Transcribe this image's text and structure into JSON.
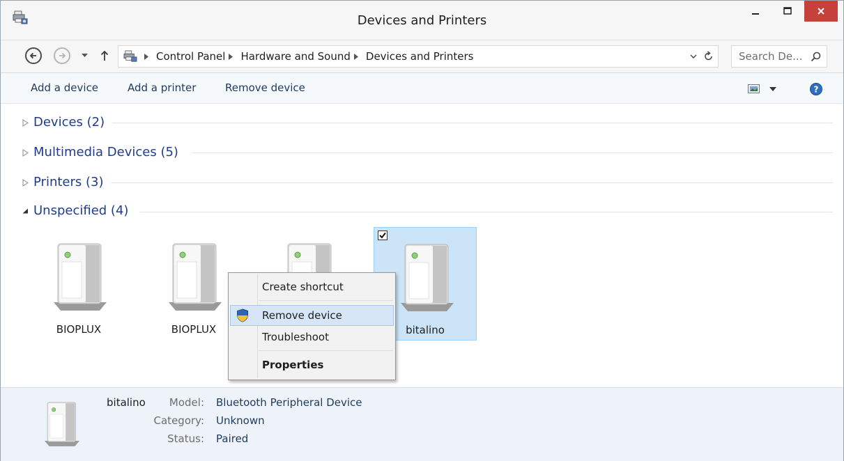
{
  "window": {
    "title": "Devices and Printers"
  },
  "address": {
    "crumbs": [
      "Control Panel",
      "Hardware and Sound",
      "Devices and Printers"
    ],
    "search_placeholder": "Search De..."
  },
  "toolbar": {
    "add_device": "Add a device",
    "add_printer": "Add a printer",
    "remove_device": "Remove device"
  },
  "groups": [
    {
      "label": "Devices (2)",
      "expanded": false
    },
    {
      "label": "Multimedia Devices (5)",
      "expanded": false
    },
    {
      "label": "Printers (3)",
      "expanded": false
    },
    {
      "label": "Unspecified (4)",
      "expanded": true
    }
  ],
  "devices": [
    {
      "label": "BIOPLUX",
      "selected": false
    },
    {
      "label": "BIOPLUX",
      "selected": false
    },
    {
      "label": "",
      "selected": false
    },
    {
      "label": "bitalino",
      "selected": true,
      "checked": true
    }
  ],
  "context_menu": {
    "items": [
      {
        "label": "Create shortcut"
      },
      {
        "label": "Remove device",
        "icon": "uac-shield-icon",
        "highlighted": true
      },
      {
        "label": "Troubleshoot"
      },
      {
        "label": "Properties",
        "bold": true
      }
    ]
  },
  "details": {
    "name": "bitalino",
    "model_label": "Model:",
    "model_value": "Bluetooth Peripheral Device",
    "category_label": "Category:",
    "category_value": "Unknown",
    "status_label": "Status:",
    "status_value": "Paired"
  },
  "colors": {
    "close_button": "#c7413b",
    "group_header": "#1e3d8a",
    "selection_fill": "#cce4f7",
    "selection_border": "#99d1ff",
    "details_background": "#eef3fa"
  }
}
